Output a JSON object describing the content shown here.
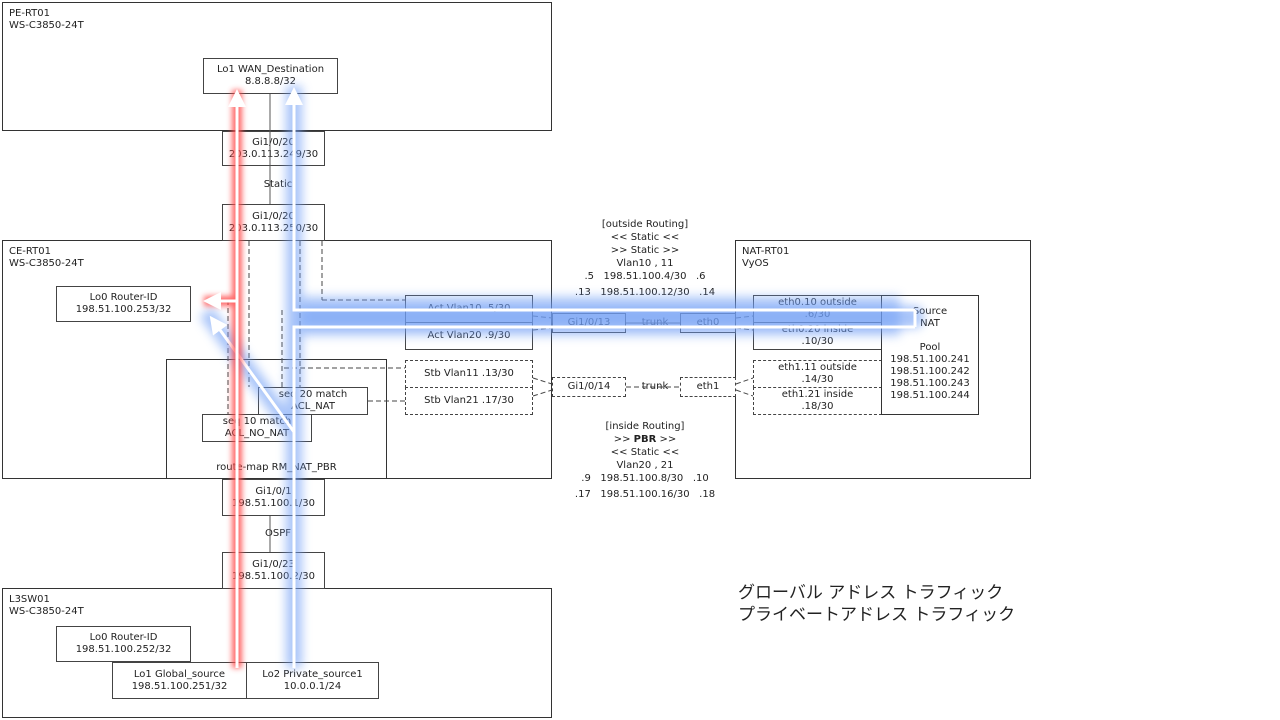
{
  "devices": {
    "pe_rt01": {
      "name": "PE-RT01",
      "model": "WS-C3850-24T"
    },
    "ce_rt01": {
      "name": "CE-RT01",
      "model": "WS-C3850-24T"
    },
    "nat_rt01": {
      "name": "NAT-RT01",
      "model": "VyOS"
    },
    "l3sw01": {
      "name": "L3SW01",
      "model": "WS-C3850-24T"
    }
  },
  "pe_rt01": {
    "lo1": {
      "name": "Lo1 WAN_Destination",
      "addr": "8.8.8.8/32"
    },
    "gi": {
      "name": "Gi1/0/20",
      "addr": "203.0.113.249/30"
    }
  },
  "link_pe_ce": {
    "protocol": "Static"
  },
  "ce_rt01": {
    "gi_up": {
      "name": "Gi1/0/20",
      "addr": "203.0.113.250/30"
    },
    "lo0": {
      "name": "Lo0 Router-ID",
      "addr": "198.51.100.253/32"
    },
    "route_map": {
      "name": "route-map RM_NAT_PBR"
    },
    "seq10": {
      "line1": "seq 10 match",
      "line2": "ACL_NO_NAT"
    },
    "seq20": {
      "line1": "seq 20 match",
      "line2": "ACL_NAT"
    },
    "act_vlan10": "Act Vlan10 .5/30",
    "act_vlan20": "Act Vlan20 .9/30",
    "stb_vlan11": "Stb Vlan11 .13/30",
    "stb_vlan21": "Stb Vlan21 .17/30",
    "gi13": "Gi1/0/13",
    "gi14": "Gi1/0/14",
    "gi_down": {
      "name": "Gi1/0/1",
      "addr": "198.51.100.1/30"
    }
  },
  "trunk_links": {
    "active": "trunk",
    "standby": "trunk"
  },
  "outside_routing": {
    "title": "[outside Routing]",
    "line1": "<< Static <<",
    "line2": ">> Static >>",
    "vlans": "Vlan10 , 11",
    "row1": {
      "left": ".5",
      "net": "198.51.100.4/30",
      "right": ".6"
    },
    "row2": {
      "left": ".13",
      "net": "198.51.100.12/30",
      "right": ".14"
    }
  },
  "inside_routing": {
    "title": "[inside Routing]",
    "line1_pre": ">> ",
    "line1_bold": "PBR",
    "line1_post": " >>",
    "line2": "<< Static <<",
    "vlans": "Vlan20 , 21",
    "row1": {
      "left": ".9",
      "net": "198.51.100.8/30",
      "right": ".10"
    },
    "row2": {
      "left": ".17",
      "net": "198.51.100.16/30",
      "right": ".18"
    }
  },
  "nat_rt01": {
    "eth0": "eth0",
    "eth1": "eth1",
    "eth0_10": {
      "name": "eth0.10 outside",
      "addr": ".6/30"
    },
    "eth0_20": {
      "name": "eth0.20 inside",
      "addr": ".10/30"
    },
    "eth1_11": {
      "name": "eth1.11 outside",
      "addr": ".14/30"
    },
    "eth1_21": {
      "name": "eth1.21 inside",
      "addr": ".18/30"
    },
    "source_nat": {
      "line1": "Source",
      "line2": "NAT",
      "pool_label": "Pool",
      "pool": [
        "198.51.100.241",
        "198.51.100.242",
        "198.51.100.243",
        "198.51.100.244"
      ]
    }
  },
  "link_ce_l3": {
    "protocol": "OSPF"
  },
  "l3sw01": {
    "gi": {
      "name": "Gi1/0/23",
      "addr": "198.51.100.2/30"
    },
    "lo0": {
      "name": "Lo0 Router-ID",
      "addr": "198.51.100.252/32"
    },
    "lo1": {
      "name": "Lo1 Global_source",
      "addr": "198.51.100.251/32"
    },
    "lo2": {
      "name": "Lo2 Private_source1",
      "addr": "10.0.0.1/24"
    }
  },
  "legend": {
    "global": {
      "label": "グローバル アドレス トラフィック",
      "color": "#ff4d4d"
    },
    "private": {
      "label": "プライベートアドレス トラフィック",
      "color": "#6f9ef5"
    }
  }
}
